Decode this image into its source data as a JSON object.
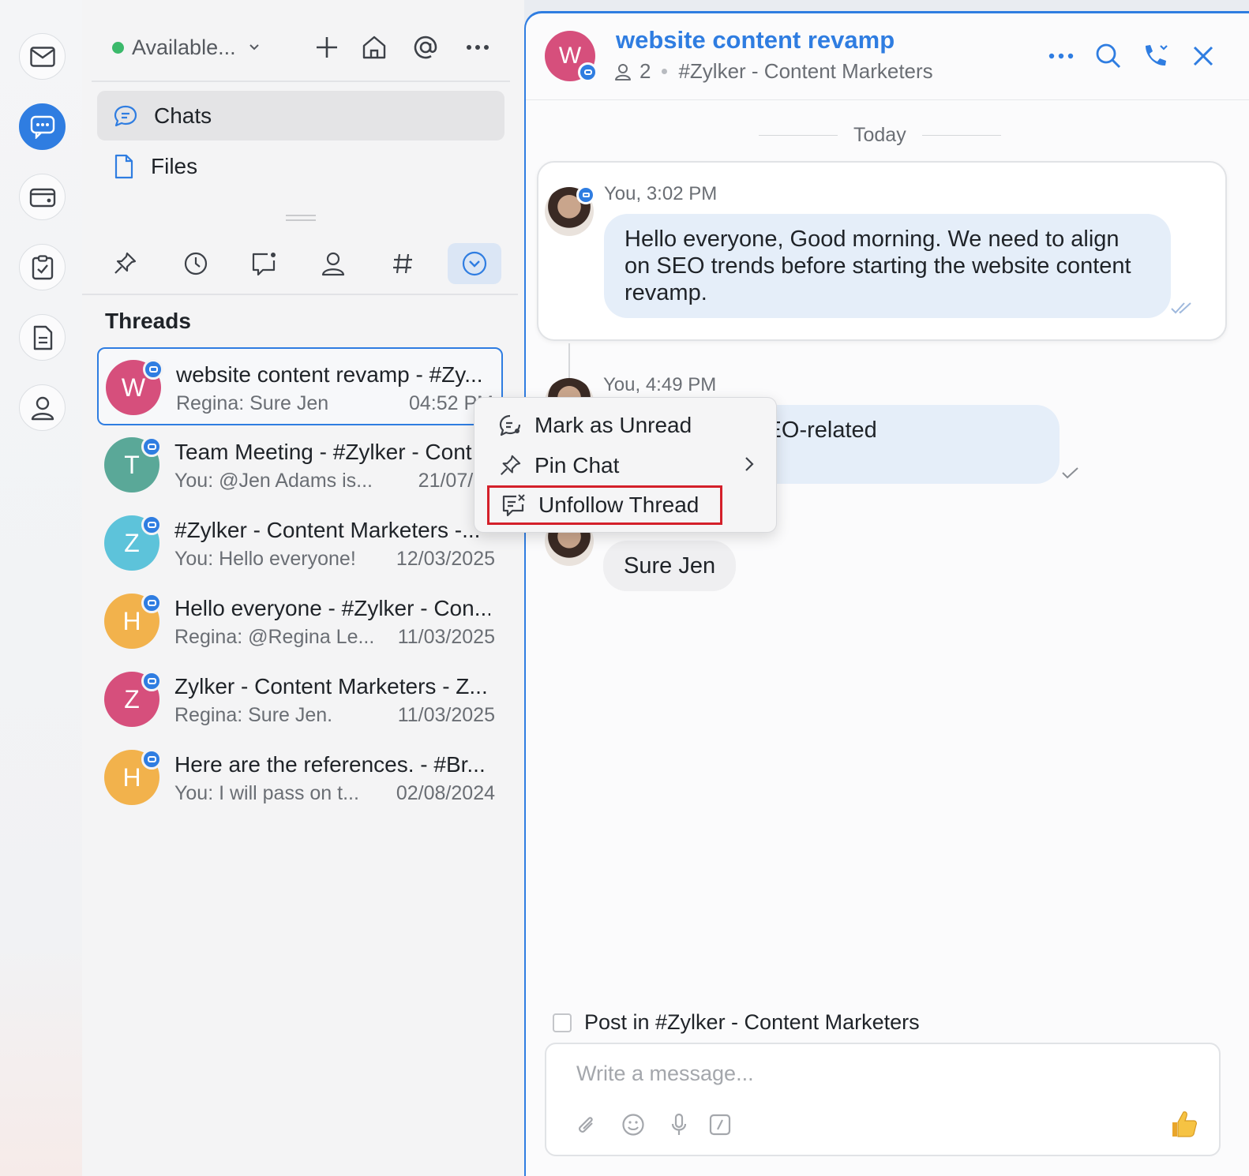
{
  "status": {
    "label": "Available...",
    "color": "#3bb96b"
  },
  "nav": {
    "chats": "Chats",
    "files": "Files"
  },
  "threads_title": "Threads",
  "threads": [
    {
      "initial": "W",
      "color": "#d64f7c",
      "title": "website content revamp - #Zy...",
      "sub": "Regina: Sure Jen",
      "date": "04:52 PM"
    },
    {
      "initial": "T",
      "color": "#5aa898",
      "title": "Team Meeting - #Zylker - Cont",
      "sub": "You: @Jen Adams  is...",
      "date": "21/07/20"
    },
    {
      "initial": "Z",
      "color": "#5dc3da",
      "title": "#Zylker - Content Marketers -...",
      "sub": "You: Hello everyone!",
      "date": "12/03/2025"
    },
    {
      "initial": "H",
      "color": "#f2b24c",
      "title": "Hello everyone - #Zylker - Con...",
      "sub": "Regina: @Regina Le...",
      "date": "11/03/2025"
    },
    {
      "initial": "Z",
      "color": "#d64f7c",
      "title": "Zylker - Content Marketers - Z...",
      "sub": "Regina: Sure Jen.",
      "date": "11/03/2025"
    },
    {
      "initial": "H",
      "color": "#f2b24c",
      "title": "Here are the references. - #Br...",
      "sub": "You: I will pass on t...",
      "date": "02/08/2024"
    }
  ],
  "chat": {
    "avatar_initial": "W",
    "title": "website content revamp",
    "member_count": "2",
    "channel": "#Zylker - Content Marketers",
    "day": "Today",
    "messages": [
      {
        "meta": "You, 3:02 PM",
        "text": "Hello everyone, Good morning. We need to align on SEO trends before starting the website content revamp."
      },
      {
        "meta": "You, 4:49 PM",
        "text": "hread for all SEO-related"
      },
      {
        "meta": "",
        "text": "Sure Jen"
      }
    ],
    "post_in_label": "Post in #Zylker - Content Marketers",
    "composer_placeholder": "Write a message..."
  },
  "context_menu": {
    "items": [
      {
        "label": "Mark as Unread"
      },
      {
        "label": "Pin Chat"
      },
      {
        "label": "Unfollow Thread"
      }
    ]
  },
  "colors": {
    "accent": "#2f7de1",
    "highlight": "#d4202a"
  }
}
